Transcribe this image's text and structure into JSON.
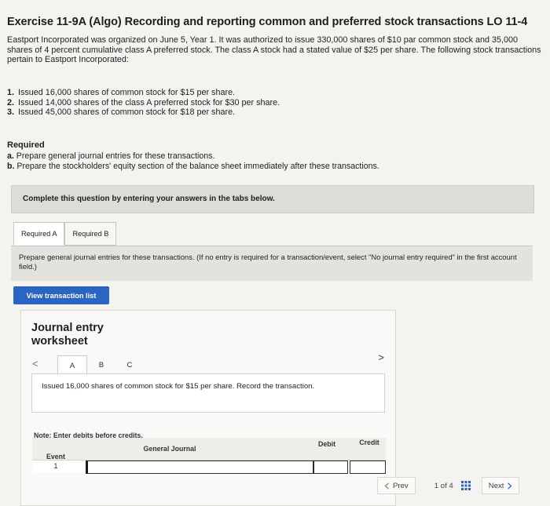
{
  "header": {
    "title": "Exercise 11-9A (Algo) Recording and reporting common and preferred stock transactions LO 11-4"
  },
  "intro": "Eastport Incorporated was organized on June 5, Year 1. It was authorized to issue 330,000 shares of $10 par common stock and 35,000 shares of 4 percent cumulative class A preferred stock. The class A stock had a stated value of $25 per share. The following stock transactions pertain to Eastport Incorporated:",
  "transactions": [
    {
      "num": "1.",
      "text": "Issued 16,000 shares of common stock for $15 per share."
    },
    {
      "num": "2.",
      "text": "Issued 14,000 shares of the class A preferred stock for $30 per share."
    },
    {
      "num": "3.",
      "text": "Issued 45,000 shares of common stock for $18 per share."
    }
  ],
  "required": {
    "heading": "Required",
    "items": [
      {
        "letter": "a.",
        "text": "Prepare general journal entries for these transactions."
      },
      {
        "letter": "b.",
        "text": "Prepare the stockholders' equity section of the balance sheet immediately after these transactions."
      }
    ]
  },
  "complete_banner": "Complete this question by entering your answers in the tabs below.",
  "tabs": [
    {
      "label": "Required A",
      "active": true
    },
    {
      "label": "Required B",
      "active": false
    }
  ],
  "instruction": "Prepare general journal entries for these transactions. (If no entry is required for a transaction/event, select \"No journal entry required\" in the first account field.)",
  "view_button": "View transaction list",
  "worksheet": {
    "title": "Journal entry worksheet",
    "prev_glyph": "<",
    "next_glyph": ">",
    "steps": [
      "A",
      "B",
      "C"
    ],
    "active_step": "A",
    "description": "Issued 16,000 shares of common stock for $15 per share. Record the transaction.",
    "note": "Note: Enter debits before credits.",
    "columns": {
      "event": "Event",
      "general_journal": "General Journal",
      "debit": "Debit",
      "credit": "Credit"
    },
    "rows": [
      {
        "event": "1"
      }
    ]
  },
  "pager": {
    "prev": "Prev",
    "info": "1 of 4",
    "next": "Next"
  },
  "colors": {
    "accent": "#2a65c1"
  },
  "icons": [
    "chevron-left-icon",
    "chevron-right-icon",
    "grid-icon"
  ]
}
